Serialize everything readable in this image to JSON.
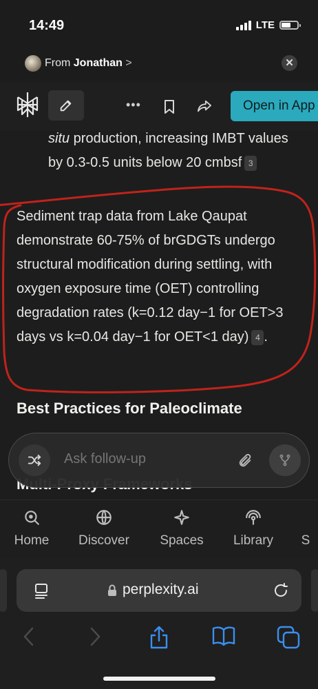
{
  "status_bar": {
    "time": "14:49",
    "network": "LTE",
    "battery_level": 0.6
  },
  "share_row": {
    "from_label": "From",
    "from_name": "Jonathan",
    "chevron": ">"
  },
  "app_bar": {
    "logo_icon": "perplexity-logo",
    "edit_icon": "edit-icon",
    "more_icon": "more-dots-icon",
    "bookmark_icon": "bookmark-icon",
    "share_icon": "share-icon",
    "open_in_app_label": "Open in App"
  },
  "content": {
    "bullet_text": "situ production, increasing IMBT values by 0.3-0.5 units below 20 cmbsf",
    "bullet_lead_italic": "situ",
    "bullet_rest": " production, increasing IMBT values by 0.3-0.5 units below 20 cmbsf",
    "bullet_citation": "3",
    "paragraph": "Sediment trap data from Lake Qaupat demonstrate 60-75% of brGDGTs undergo structural modification during settling, with oxygen exposure time (OET) controlling degradation rates (k=0.12 day−1 for OET>3 days vs k=0.04 day−1 for OET<1 day)",
    "paragraph_citation": "4",
    "paragraph_end": ".",
    "heading": "Best Practices for Paleoclimate",
    "heading_line2": "Multi-Proxy Frameworks",
    "annotation_color": "#c0231b"
  },
  "ask_bar": {
    "placeholder": "Ask follow-up",
    "shuffle_icon": "shuffle-icon",
    "attach_icon": "paperclip-icon",
    "voice_icon": "voice-branch-icon"
  },
  "tabs": [
    {
      "label": "Home",
      "icon": "home-search-icon"
    },
    {
      "label": "Discover",
      "icon": "globe-icon"
    },
    {
      "label": "Spaces",
      "icon": "sparkle-icon"
    },
    {
      "label": "Library",
      "icon": "library-icon"
    },
    {
      "label": "S",
      "icon": ""
    }
  ],
  "browser": {
    "url": "perplexity.ai",
    "reader_icon": "reader-icon",
    "lock_icon": "lock-icon",
    "reload_icon": "reload-icon",
    "nav": {
      "back_icon": "back-icon",
      "forward_icon": "forward-icon",
      "share_icon": "share-icon",
      "bookmarks_icon": "book-icon",
      "tabs_icon": "tabs-icon"
    }
  }
}
